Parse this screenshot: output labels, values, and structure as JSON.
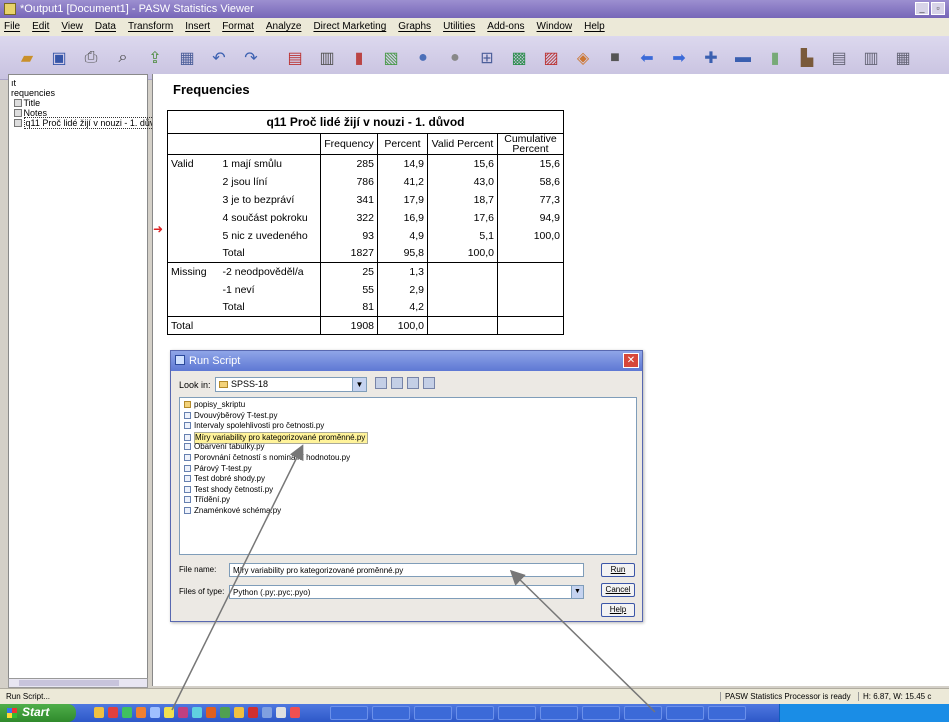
{
  "window": {
    "title": "*Output1 [Document1] - PASW Statistics Viewer"
  },
  "menu": [
    "File",
    "Edit",
    "View",
    "Data",
    "Transform",
    "Insert",
    "Format",
    "Analyze",
    "Direct Marketing",
    "Graphs",
    "Utilities",
    "Add-ons",
    "Window",
    "Help"
  ],
  "outline": {
    "root": "ıt",
    "items": [
      "requencies",
      "Title",
      "Notes",
      "q11 Proč lidé žijí v nouzi - 1. dův"
    ]
  },
  "viewer": {
    "heading": "Frequencies",
    "table": {
      "caption": "q11 Proč lidé žijí v nouzi - 1. důvod",
      "headers": [
        "Frequency",
        "Percent",
        "Valid Percent",
        "Cumulative Percent"
      ],
      "rows": [
        {
          "group": "Valid",
          "label": "1 mají smůlu",
          "freq": "285",
          "pct": "14,9",
          "valid": "15,6",
          "cum": "15,6"
        },
        {
          "group": "",
          "label": "2 jsou líní",
          "freq": "786",
          "pct": "41,2",
          "valid": "43,0",
          "cum": "58,6"
        },
        {
          "group": "",
          "label": "3 je to bezpráví",
          "freq": "341",
          "pct": "17,9",
          "valid": "18,7",
          "cum": "77,3"
        },
        {
          "group": "",
          "label": "4 součást pokroku",
          "freq": "322",
          "pct": "16,9",
          "valid": "17,6",
          "cum": "94,9"
        },
        {
          "group": "",
          "label": "5 nic z uvedeného",
          "freq": "93",
          "pct": "4,9",
          "valid": "5,1",
          "cum": "100,0"
        },
        {
          "group": "",
          "label": "Total",
          "freq": "1827",
          "pct": "95,8",
          "valid": "100,0",
          "cum": ""
        },
        {
          "group": "Missing",
          "label": "-2 neodpověděl/a",
          "freq": "25",
          "pct": "1,3",
          "valid": "",
          "cum": ""
        },
        {
          "group": "",
          "label": "-1 neví",
          "freq": "55",
          "pct": "2,9",
          "valid": "",
          "cum": ""
        },
        {
          "group": "",
          "label": "Total",
          "freq": "81",
          "pct": "4,2",
          "valid": "",
          "cum": ""
        },
        {
          "group": "Total",
          "label": "",
          "freq": "1908",
          "pct": "100,0",
          "valid": "",
          "cum": ""
        }
      ]
    }
  },
  "dialog": {
    "title": "Run Script",
    "look_in_label": "Look in:",
    "look_in_value": "SPSS-18",
    "files": [
      {
        "name": "popisy_skriptu",
        "type": "folder"
      },
      {
        "name": "Dvouvýběrový T-test.py",
        "type": "file"
      },
      {
        "name": "Intervaly spolehlivosti pro četnosti.py",
        "type": "file"
      },
      {
        "name": "Míry variability pro kategorizované proměnné.py",
        "type": "file",
        "selected": true
      },
      {
        "name": "Obarvení tabulky.py",
        "type": "file"
      },
      {
        "name": "Porovnání četností s nominální hodnotou.py",
        "type": "file"
      },
      {
        "name": "Párový T-test.py",
        "type": "file"
      },
      {
        "name": "Test dobré shody.py",
        "type": "file"
      },
      {
        "name": "Test shody četností.py",
        "type": "file"
      },
      {
        "name": "Třídění.py",
        "type": "file"
      },
      {
        "name": "Znaménkové schéma.py",
        "type": "file"
      }
    ],
    "file_name_label": "File name:",
    "file_name_value": "Míry variability pro kategorizované proměnné.py",
    "file_type_label": "Files of type:",
    "file_type_value": "Python (.py;.pyc;.pyo)",
    "run_button": "Run",
    "cancel_button": "Cancel",
    "help_button": "Help"
  },
  "status": {
    "left": "Run Script...",
    "processor": "PASW Statistics Processor is ready",
    "dimensions": "H: 6.87, W: 15.45 c"
  },
  "taskbar": {
    "start": "Start"
  }
}
